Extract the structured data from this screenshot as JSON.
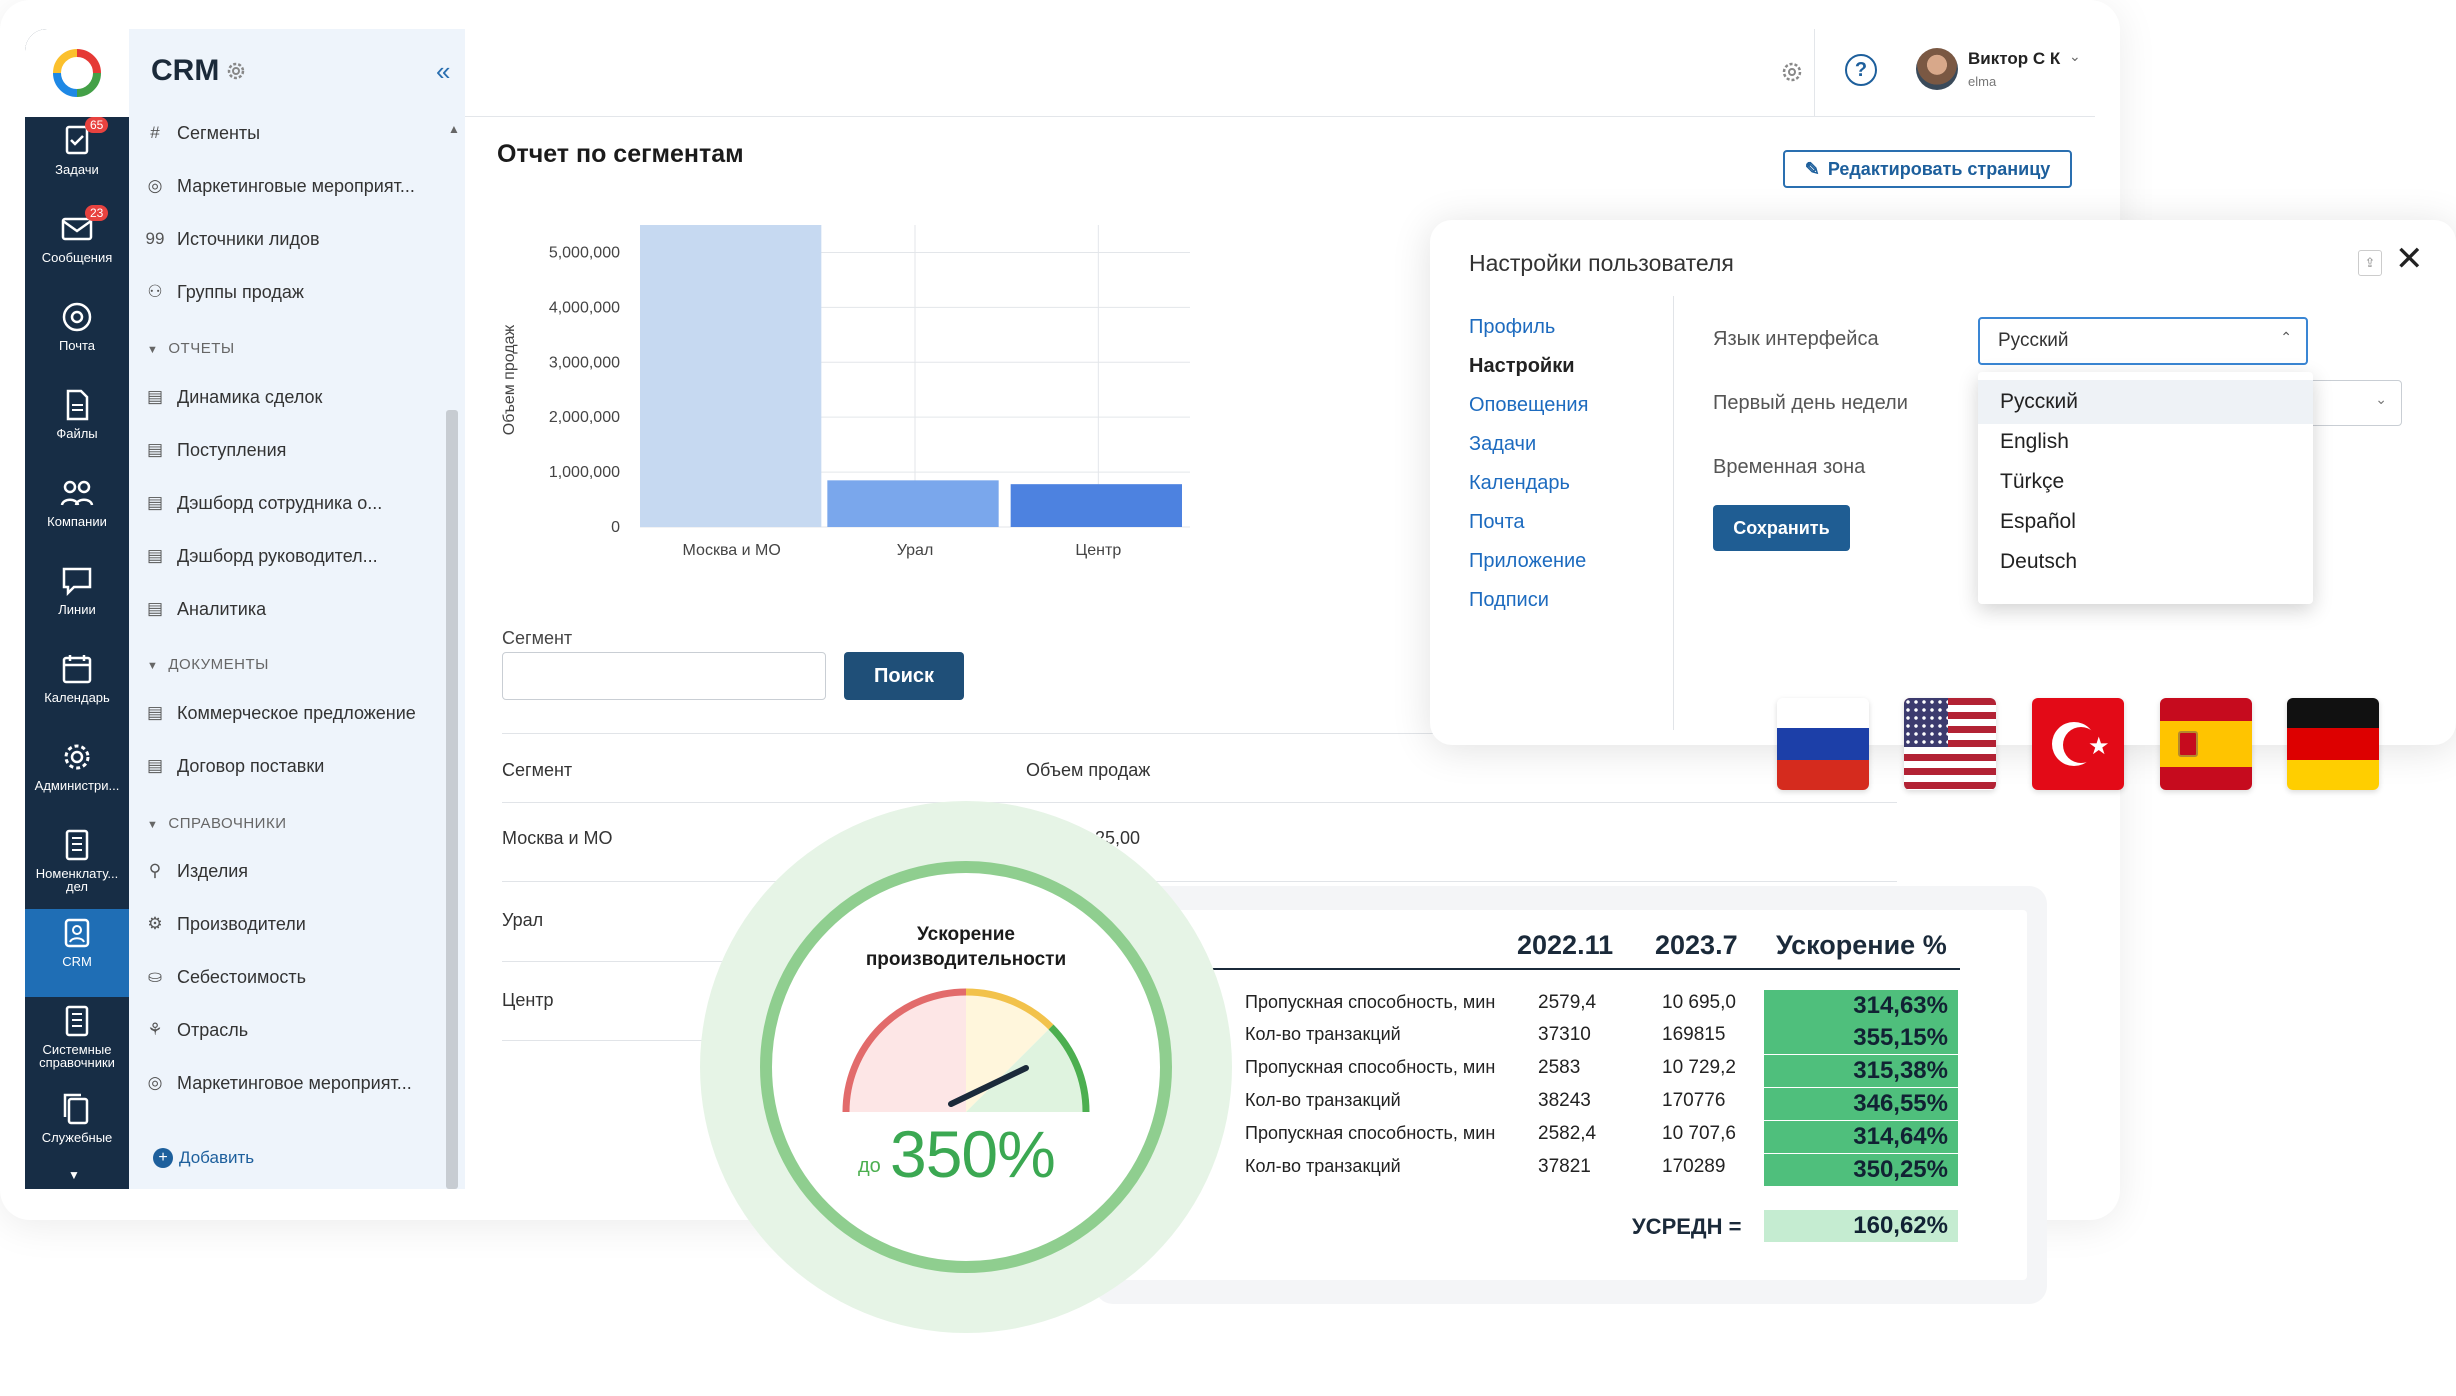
{
  "app": {
    "name": "CRM",
    "user_name": "Виктор С К",
    "user_org": "elma"
  },
  "rail": [
    {
      "label": "Задачи",
      "icon": "tasks-icon",
      "badge": "65"
    },
    {
      "label": "Сообщения",
      "icon": "mail-icon",
      "badge": "23"
    },
    {
      "label": "Почта",
      "icon": "at-icon",
      "badge": ""
    },
    {
      "label": "Файлы",
      "icon": "file-icon",
      "badge": ""
    },
    {
      "label": "Компании",
      "icon": "people-icon",
      "badge": ""
    },
    {
      "label": "Линии",
      "icon": "chat-icon",
      "badge": ""
    },
    {
      "label": "Календарь",
      "icon": "calendar-icon",
      "badge": ""
    },
    {
      "label": "Администри...",
      "icon": "gear-icon",
      "badge": ""
    },
    {
      "label": "Номенклату... дел",
      "icon": "book-icon",
      "badge": ""
    },
    {
      "label": "CRM",
      "icon": "crm-icon",
      "badge": ""
    },
    {
      "label": "Системные справочники",
      "icon": "book-icon",
      "badge": ""
    },
    {
      "label": "Служебные",
      "icon": "copy-icon",
      "badge": ""
    }
  ],
  "sidebar": {
    "items": [
      {
        "label": "Сегменты",
        "icon": "#"
      },
      {
        "label": "Маркетинговые мероприят...",
        "icon": "◎"
      },
      {
        "label": "Источники лидов",
        "icon": "99"
      },
      {
        "label": "Группы продаж",
        "icon": "⚇"
      }
    ],
    "reports_header": "ОТЧЕТЫ",
    "reports": [
      "Динамика сделок",
      "Поступления",
      "Дэшборд сотрудника о...",
      "Дэшборд руководител...",
      "Аналитика"
    ],
    "docs_header": "ДОКУМЕНТЫ",
    "docs": [
      "Коммерческое предложение",
      "Договор поставки"
    ],
    "refs_header": "СПРАВОЧНИКИ",
    "refs": [
      "Изделия",
      "Производители",
      "Себестоимость",
      "Отрасль",
      "Маркетинговое мероприят..."
    ],
    "add_label": "Добавить"
  },
  "page": {
    "title": "Отчет по сегментам",
    "edit_button": "Редактировать страницу",
    "segment_label": "Сегмент",
    "search_button": "Поиск"
  },
  "chart_data": {
    "type": "bar",
    "categories": [
      "Москва и МО",
      "Урал",
      "Центр"
    ],
    "values": [
      5800000,
      850000,
      780000
    ],
    "ylabel": "Объем продаж",
    "ylim": [
      0,
      5500000
    ],
    "yticks": [
      "5,000,000",
      "4,000,000",
      "3,000,000",
      "2,000,000",
      "1,000,000",
      "0"
    ],
    "colors": [
      "#c6d9f1",
      "#7aa7ec",
      "#4d82e0"
    ]
  },
  "table": {
    "headers": [
      "Сегмент",
      "Объем продаж"
    ],
    "rows": [
      {
        "segment": "Москва и МО",
        "value": "...25,00"
      },
      {
        "segment": "Урал",
        "value": ""
      },
      {
        "segment": "Центр",
        "value": ""
      }
    ]
  },
  "settings": {
    "title": "Настройки пользователя",
    "nav": [
      "Профиль",
      "Настройки",
      "Оповещения",
      "Задачи",
      "Календарь",
      "Почта",
      "Приложение",
      "Подписи"
    ],
    "selected_nav": "Настройки",
    "fields": {
      "language_label": "Язык интерфейса",
      "week_label": "Первый день недели",
      "tz_label": "Временная зона"
    },
    "language_value": "Русский",
    "language_options": [
      "Русский",
      "English",
      "Türkçe",
      "Español",
      "Deutsch"
    ],
    "save_button": "Сохранить"
  },
  "flags": [
    "ru",
    "us",
    "tr",
    "es",
    "de"
  ],
  "gauge": {
    "title": "Ускорение производительности",
    "prefix": "до",
    "value": "350%"
  },
  "perf": {
    "headers": [
      "2022.11",
      "2023.7",
      "Ускорение %"
    ],
    "rows": [
      {
        "label": "Пропускная способность, мин",
        "a": "2579,4",
        "b": "10 695,0",
        "pct": "314,63%"
      },
      {
        "label": "Кол-во транзакций",
        "a": "37310",
        "b": "169815",
        "pct": "355,15%"
      },
      {
        "label": "Пропускная способность, мин",
        "a": "2583",
        "b": "10 729,2",
        "pct": "315,38%"
      },
      {
        "label": "Кол-во транзакций",
        "a": "38243",
        "b": "170776",
        "pct": "346,55%"
      },
      {
        "label": "Пропускная способность, мин",
        "a": "2582,4",
        "b": "10 707,6",
        "pct": "314,64%"
      },
      {
        "label": "Кол-во транзакций",
        "a": "37821",
        "b": "170289",
        "pct": "350,25%"
      }
    ],
    "avg_label": "УСРЕДН =",
    "avg_value": "160,62%"
  }
}
